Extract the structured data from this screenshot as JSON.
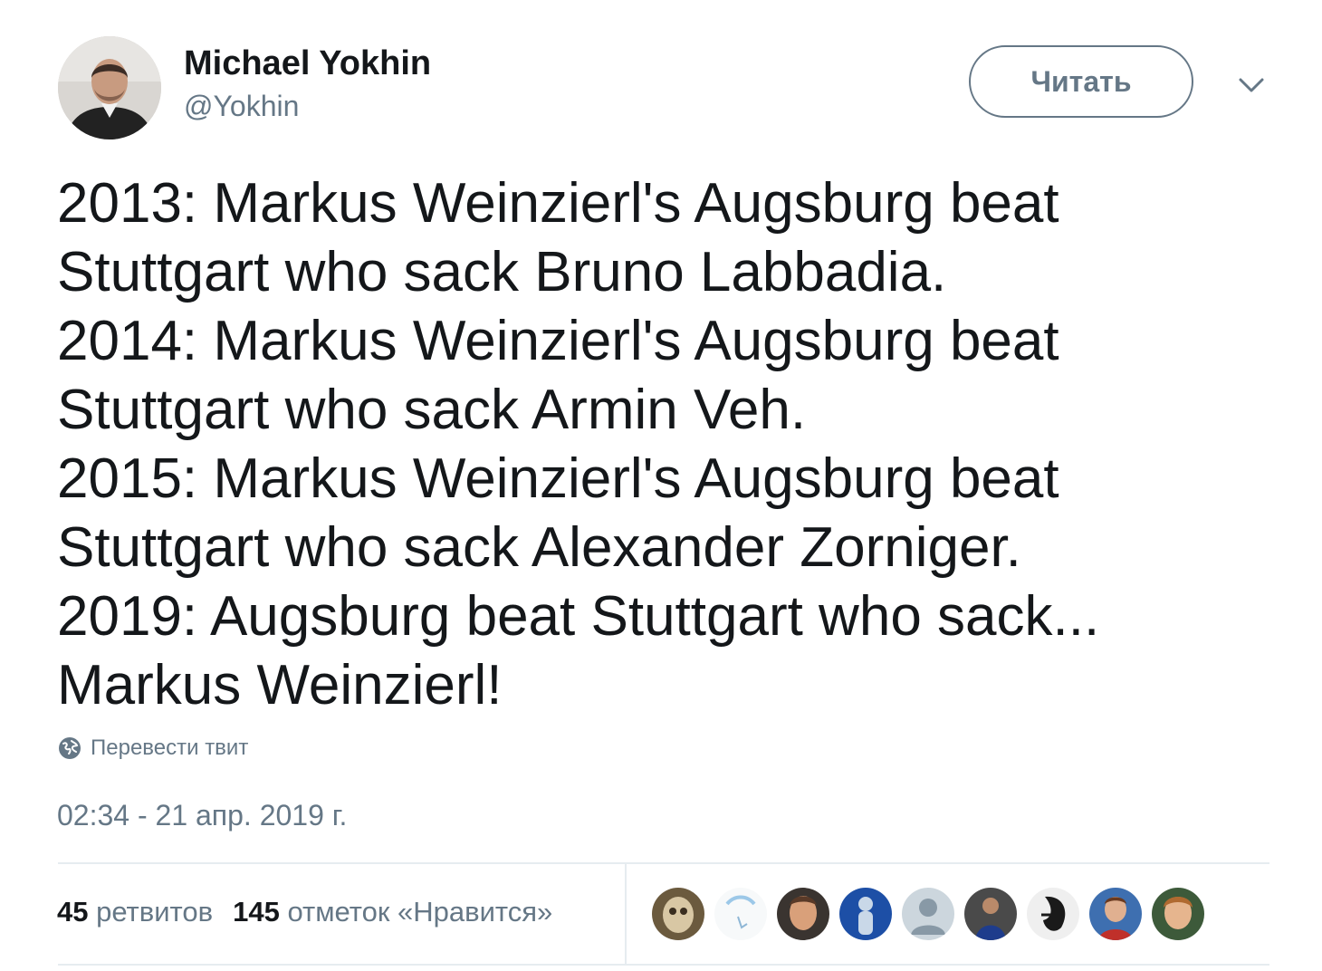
{
  "author": {
    "name": "Michael Yokhin",
    "handle": "@Yokhin"
  },
  "follow_button_label": "Читать",
  "tweet_lines": [
    "2013: Markus Weinzierl's Augsburg beat",
    "Stuttgart who sack Bruno Labbadia.",
    "2014: Markus Weinzierl's Augsburg beat",
    "Stuttgart who sack Armin Veh.",
    "2015: Markus Weinzierl's Augsburg beat",
    "Stuttgart who sack Alexander Zorniger.",
    "2019: Augsburg beat Stuttgart who sack...",
    "Markus Weinzierl!"
  ],
  "translate_label": "Перевести твит",
  "timestamp": "02:34 - 21 апр. 2019 г.",
  "stats": {
    "retweets_count": "45",
    "retweets_label": "ретвитов",
    "likes_count": "145",
    "likes_label": "отметок «Нравится»"
  },
  "icons": {
    "translate": "globe-icon",
    "menu": "chevron-down-icon"
  },
  "colors": {
    "text": "#14171a",
    "secondary": "#657786",
    "divider": "#e6ecf0"
  },
  "liker_avatar_count": 9
}
